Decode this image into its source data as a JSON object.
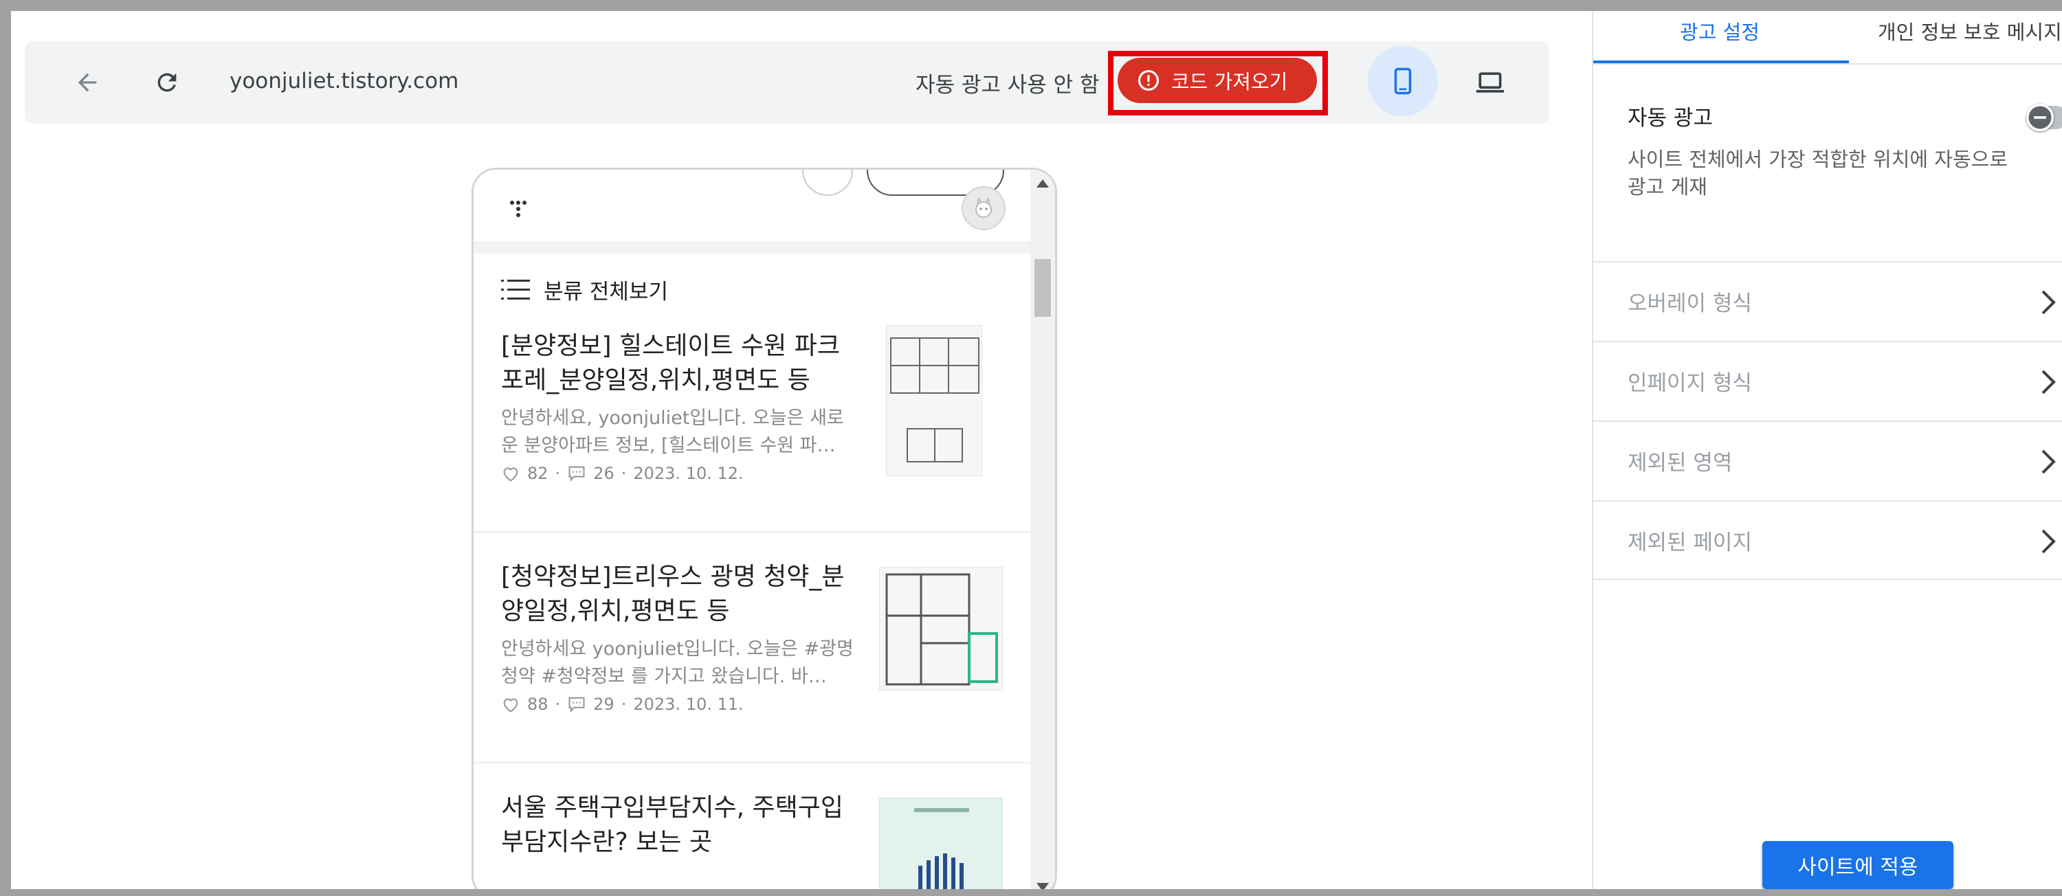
{
  "toolbar": {
    "url": "yoonjuliet.tistory.com",
    "auto_ad_status": "자동 광고 사용 안 함",
    "get_code_label": "코드 가져오기",
    "icons": [
      "back-arrow-icon",
      "reload-icon",
      "alert-circle-icon",
      "mobile-phone-icon",
      "laptop-icon"
    ]
  },
  "preview": {
    "category_label": "분류 전체보기",
    "posts": [
      {
        "title": "[분양정보] 힐스테이트 수원 파크 포레_분양일정,위치,평면도 등",
        "excerpt": "안녕하세요, yoonjuliet입니다. 오늘은 새로운 분양아파트 정보, [힐스테이트 수원 파…",
        "likes": "82",
        "comments": "26",
        "date": "2023. 10. 12."
      },
      {
        "title": "[청약정보]트리우스 광명 청약_분양일정,위치,평면도 등",
        "excerpt": "안녕하세요 yoonjuliet입니다. 오늘은 #광명청약 #청약정보 를 가지고 왔습니다. 바…",
        "likes": "88",
        "comments": "29",
        "date": "2023. 10. 11."
      },
      {
        "title": "서울 주택구입부담지수, 주택구입부담지수란? 보는 곳"
      }
    ]
  },
  "panel": {
    "tabs": [
      {
        "label": "광고 설정",
        "active": true
      },
      {
        "label": "개인 정보 보호 메시지",
        "active": false
      }
    ],
    "auto_ad": {
      "title": "자동 광고",
      "description": "사이트 전체에서 가장 적합한 위치에 자동으로 광고 게재",
      "toggle_on": false
    },
    "options": [
      {
        "label": "오버레이 형식"
      },
      {
        "label": "인페이지 형식"
      },
      {
        "label": "제외된 영역"
      },
      {
        "label": "제외된 페이지"
      }
    ],
    "apply_label": "사이트에 적용"
  },
  "colors": {
    "accent": "#1a73e8",
    "danger": "#d93025",
    "highlight_box": "#e6000b"
  }
}
